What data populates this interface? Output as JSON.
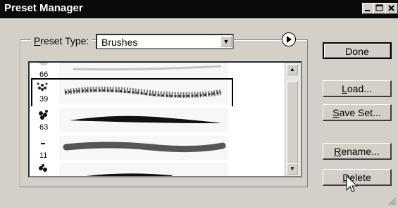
{
  "window": {
    "title": "Preset Manager",
    "minimize_glyph": "_",
    "maximize_glyph": "□",
    "close_glyph": "X"
  },
  "preset_type": {
    "label": "Preset Type:",
    "value": "Brushes"
  },
  "brush_list": {
    "items": [
      {
        "count": "66",
        "kind": "soft-spray",
        "stroke_color": "#b9b9b9"
      },
      {
        "count": "39",
        "kind": "spatter-stroke",
        "stroke_color": "#3a3a3a",
        "selected": true
      },
      {
        "count": "63",
        "kind": "tapered-stroke",
        "stroke_color": "#111111"
      },
      {
        "count": "11",
        "kind": "gray-stroke",
        "stroke_color": "#555555"
      },
      {
        "count": "",
        "kind": "partial-stroke",
        "stroke_color": "#111111"
      }
    ]
  },
  "buttons": {
    "done": "Done",
    "load": "Load...",
    "save_set": "Save Set...",
    "rename": "Rename...",
    "delete": "Delete"
  },
  "icons": [
    "menu-arrow-icon",
    "scroll-up-icon",
    "scroll-down-icon",
    "dropdown-arrow-icon",
    "mouse-cursor-icon",
    "resize-grip-icon"
  ],
  "colors": {
    "titlebar": "#0a0a0a",
    "dialog_face": "#d4d0c8"
  }
}
